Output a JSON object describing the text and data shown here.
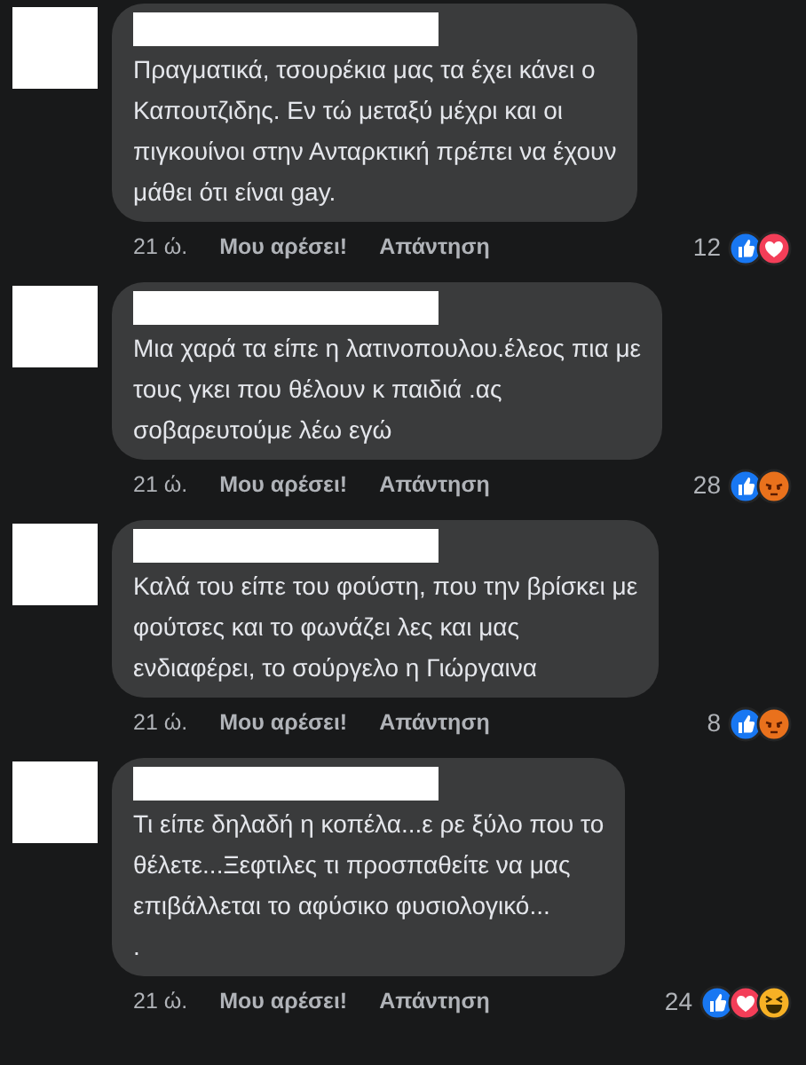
{
  "comments": [
    {
      "text": "Πραγματικά, τσουρέκια μας τα έχει κάνει ο\nΚαπουτζιδης. Εν τώ μεταξύ μέχρι και οι\nπιγκουίνοι στην Ανταρκτική πρέπει να έχουν\nμάθει ότι είναι gay.",
      "time": "21 ώ.",
      "like": "Μου αρέσει!",
      "reply": "Απάντηση",
      "count": "12",
      "reactions": [
        {
          "kind": "like"
        },
        {
          "kind": "love"
        }
      ]
    },
    {
      "text": "Μια χαρά τα είπε η λατινοπουλου.έλεος πια με\nτους γκει που θέλουν κ παιδιά .ας\nσοβαρευτούμε λέω εγώ",
      "time": "21 ώ.",
      "like": "Μου αρέσει!",
      "reply": "Απάντηση",
      "count": "28",
      "reactions": [
        {
          "kind": "like"
        },
        {
          "kind": "angry"
        }
      ]
    },
    {
      "text": "Καλά του είπε του φούστη, που την βρίσκει με\nφούτσες και το φωνάζει λες και μας\nενδιαφέρει, το σούργελο η Γιώργαινα",
      "time": "21 ώ.",
      "like": "Μου αρέσει!",
      "reply": "Απάντηση",
      "count": "8",
      "reactions": [
        {
          "kind": "like"
        },
        {
          "kind": "angry"
        }
      ]
    },
    {
      "text": "Τι είπε δηλαδή η κοπέλα...ε ρε ξύλο που το\nθέλετε...Ξεφτιλες τι προσπαθείτε να μας\nεπιβάλλεται το αφύσικο φυσιολογικό...\n.",
      "time": "21 ώ.",
      "like": "Μου αρέσει!",
      "reply": "Απάντηση",
      "count": "24",
      "reactions": [
        {
          "kind": "like"
        },
        {
          "kind": "love"
        },
        {
          "kind": "haha"
        }
      ]
    }
  ]
}
